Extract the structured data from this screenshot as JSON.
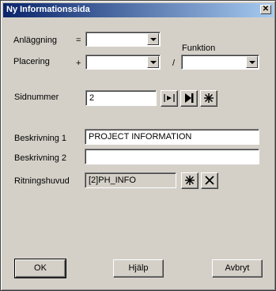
{
  "window": {
    "title": "Ny Informationssida",
    "close_glyph": "✕"
  },
  "fields": {
    "anlaggning": {
      "label": "Anläggning",
      "prefix": "=",
      "value": ""
    },
    "placering": {
      "label": "Placering",
      "prefix": "+",
      "value": ""
    },
    "funktion": {
      "label": "Funktion",
      "prefix": "/",
      "value": ""
    },
    "sidnummer": {
      "label": "Sidnummer",
      "value": "2"
    },
    "beskrivning1": {
      "label": "Beskrivning 1",
      "value": "PROJECT INFORMATION"
    },
    "beskrivning2": {
      "label": "Beskrivning 2",
      "value": ""
    },
    "ritningshuvud": {
      "label": "Ritningshuvud",
      "value": "[2]PH_INFO"
    }
  },
  "icons": {
    "skip_icon": "skip-to-marker-icon",
    "next_icon": "next-page-icon",
    "new_icon": "asterisk-new-icon",
    "browse_icon": "asterisk-new-icon",
    "clear_icon": "clear-x-icon"
  },
  "buttons": {
    "ok": "OK",
    "help": "Hjälp",
    "cancel": "Avbryt"
  }
}
